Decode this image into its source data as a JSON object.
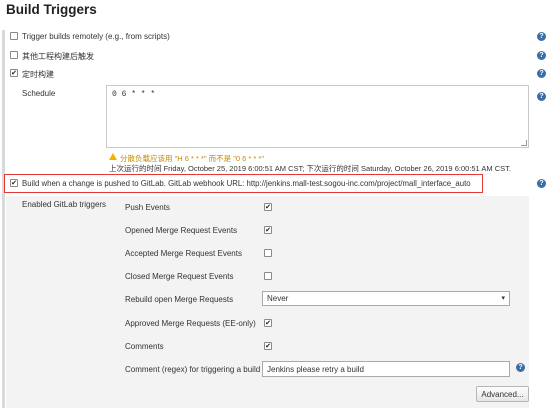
{
  "section": {
    "title": "Build Triggers"
  },
  "triggers": [
    {
      "label": "Trigger builds remotely (e.g., from scripts)",
      "checked": false
    },
    {
      "label": "其他工程构建后触发",
      "checked": false
    },
    {
      "label": "定时构建",
      "checked": true
    }
  ],
  "schedule": {
    "label": "Schedule",
    "value": "0 6 * * *",
    "warning": "分散负载应该用 \"H 6 * * *\" 而不是 \"0 6 * * *\"",
    "info": "上次运行的时间 Friday, October 25, 2019 6:00:51 AM CST; 下次运行的时间 Saturday, October 26, 2019 6:00:51 AM CST."
  },
  "gitlab": {
    "trigger_label": "Build when a change is pushed to GitLab. GitLab webhook URL: http://jenkins.mall-test.sogou-inc.com/project/mall_interface_auto",
    "trigger_checked": true,
    "enabled_label": "Enabled GitLab triggers",
    "options": [
      {
        "label": "Push Events",
        "checked": true
      },
      {
        "label": "Opened Merge Request Events",
        "checked": true
      },
      {
        "label": "Accepted Merge Request Events",
        "checked": false
      },
      {
        "label": "Closed Merge Request Events",
        "checked": false
      }
    ],
    "rebuild_label": "Rebuild open Merge Requests",
    "rebuild_value": "Never",
    "approved": {
      "label": "Approved Merge Requests (EE-only)",
      "checked": true
    },
    "comments": {
      "label": "Comments",
      "checked": true
    },
    "comment_regex_label": "Comment (regex) for triggering a build",
    "comment_regex_value": "Jenkins please retry a build",
    "advanced_label": "Advanced..."
  },
  "icons": {
    "help": "question-mark-circle-icon",
    "warning": "warning-triangle-icon",
    "check": "✔"
  },
  "colors": {
    "help": "#3a6ea8",
    "highlight_border": "#e53935",
    "warning_text": "#c48a00"
  },
  "glyphs": {
    "help": "?",
    "dropdown": "▾"
  }
}
